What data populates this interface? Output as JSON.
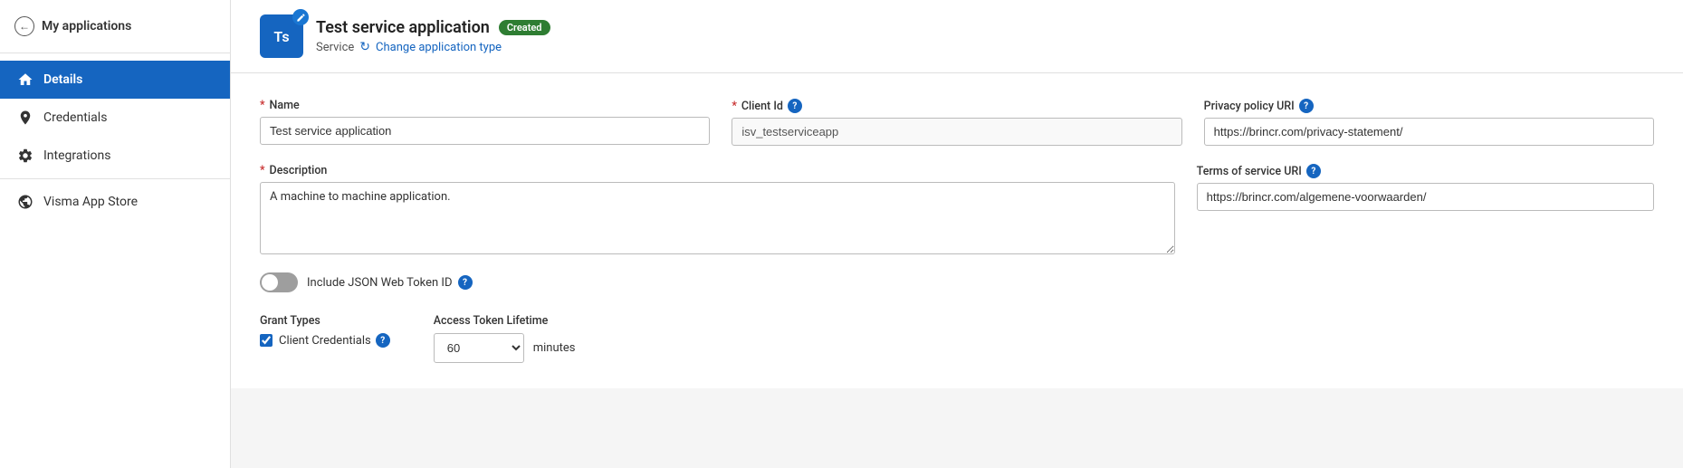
{
  "sidebar": {
    "back_label": "My applications",
    "items": [
      {
        "id": "details",
        "label": "Details",
        "active": true
      },
      {
        "id": "credentials",
        "label": "Credentials",
        "active": false
      },
      {
        "id": "integrations",
        "label": "Integrations",
        "active": false
      },
      {
        "id": "visma-app-store",
        "label": "Visma App Store",
        "active": false
      }
    ]
  },
  "header": {
    "avatar_initials": "Ts",
    "app_title": "Test service application",
    "status_badge": "Created",
    "subtitle_type": "Service",
    "change_link": "Change application type"
  },
  "form": {
    "name_label": "*Name",
    "name_value": "Test service application",
    "client_id_label": "*Client Id",
    "client_id_value": "isv_testserviceapp",
    "privacy_policy_label": "Privacy policy URI",
    "privacy_policy_value": "https://brincr.com/privacy-statement/",
    "description_label": "*Description",
    "description_value": "A machine to machine application.",
    "terms_of_service_label": "Terms of service URI",
    "terms_of_service_value": "https://brincr.com/algemene-voorwaarden/",
    "toggle_label": "Include JSON Web Token ID",
    "toggle_enabled": false,
    "grant_types_label": "Grant Types",
    "client_credentials_label": "Client Credentials",
    "access_token_lifetime_label": "Access Token Lifetime",
    "access_token_lifetime_value": "60",
    "access_token_unit": "minutes"
  }
}
